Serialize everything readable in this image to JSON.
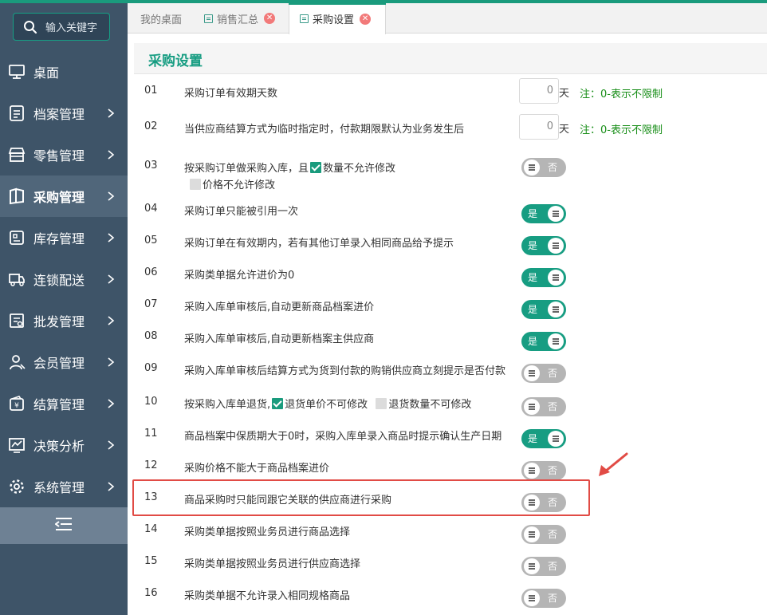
{
  "search": {
    "placeholder": "输入关键字"
  },
  "sidebar": {
    "items": [
      {
        "label": "桌面",
        "icon": "monitor-icon",
        "chevron": false,
        "active": false
      },
      {
        "label": "档案管理",
        "icon": "file-icon",
        "chevron": true,
        "active": false
      },
      {
        "label": "零售管理",
        "icon": "shop-icon",
        "chevron": true,
        "active": false
      },
      {
        "label": "采购管理",
        "icon": "book-icon",
        "chevron": true,
        "active": true
      },
      {
        "label": "库存管理",
        "icon": "inventory-icon",
        "chevron": true,
        "active": false
      },
      {
        "label": "连锁配送",
        "icon": "truck-icon",
        "chevron": true,
        "active": false
      },
      {
        "label": "批发管理",
        "icon": "wholesale-icon",
        "chevron": true,
        "active": false
      },
      {
        "label": "会员管理",
        "icon": "user-icon",
        "chevron": true,
        "active": false
      },
      {
        "label": "结算管理",
        "icon": "wallet-icon",
        "chevron": true,
        "active": false
      },
      {
        "label": "决策分析",
        "icon": "chart-icon",
        "chevron": true,
        "active": false
      },
      {
        "label": "系统管理",
        "icon": "gear-icon",
        "chevron": true,
        "active": false
      }
    ],
    "collapse_icon": "collapse-menu-icon"
  },
  "tabs": [
    {
      "label": "我的桌面",
      "icon": false,
      "closable": false,
      "active": false
    },
    {
      "label": "销售汇总",
      "icon": true,
      "closable": true,
      "active": false
    },
    {
      "label": "采购设置",
      "icon": true,
      "closable": true,
      "active": true
    }
  ],
  "page": {
    "title": "采购设置"
  },
  "settings": [
    {
      "num": "01",
      "label": "采购订单有效期天数",
      "type": "number",
      "value": "0",
      "unit": "天",
      "note": "注：0-表示不限制"
    },
    {
      "num": "02",
      "label": "当供应商结算方式为临时指定时，付款期限默认为业务发生后",
      "type": "number",
      "value": "0",
      "unit": "天",
      "note": "注：0-表示不限制"
    },
    {
      "num": "03",
      "label": "按采购订单做采购入库，且",
      "type": "toggle",
      "on": false,
      "cb1_label": "数量不允许修改",
      "cb1_checked": true,
      "cb2_label": "价格不允许修改",
      "cb2_checked": false
    },
    {
      "num": "04",
      "label": "采购订单只能被引用一次",
      "type": "toggle",
      "on": true
    },
    {
      "num": "05",
      "label": "采购订单在有效期内，若有其他订单录入相同商品给予提示",
      "type": "toggle",
      "on": true
    },
    {
      "num": "06",
      "label": "采购类单据允许进价为0",
      "type": "toggle",
      "on": true
    },
    {
      "num": "07",
      "label": "采购入库单审核后,自动更新商品档案进价",
      "type": "toggle",
      "on": true
    },
    {
      "num": "08",
      "label": "采购入库单审核后,自动更新档案主供应商",
      "type": "toggle",
      "on": true
    },
    {
      "num": "09",
      "label": "采购入库单审核后结算方式为货到付款的购销供应商立刻提示是否付款",
      "type": "toggle",
      "on": false
    },
    {
      "num": "10",
      "label": "按采购入库单退货,",
      "type": "toggle",
      "on": false,
      "cb1_label": "退货单价不可修改",
      "cb1_checked": true,
      "cb2_label": "退货数量不可修改",
      "cb2_checked": false
    },
    {
      "num": "11",
      "label": "商品档案中保质期大于0时，采购入库单录入商品时提示确认生产日期",
      "type": "toggle",
      "on": true
    },
    {
      "num": "12",
      "label": "采购价格不能大于商品档案进价",
      "type": "toggle",
      "on": false
    },
    {
      "num": "13",
      "label": "商品采购时只能同跟它关联的供应商进行采购",
      "type": "toggle",
      "on": false
    },
    {
      "num": "14",
      "label": "采购类单据按照业务员进行商品选择",
      "type": "toggle",
      "on": false
    },
    {
      "num": "15",
      "label": "采购类单据按照业务员进行供应商选择",
      "type": "toggle",
      "on": false
    },
    {
      "num": "16",
      "label": "采购类单据不允许录入相同规格商品",
      "type": "toggle",
      "on": false
    }
  ],
  "toggle_labels": {
    "on": "是",
    "off": "否"
  },
  "colors": {
    "accent": "#179d82",
    "sidebar": "#3e5468",
    "note": "#1a8f1a",
    "highlight": "#e14b45"
  }
}
